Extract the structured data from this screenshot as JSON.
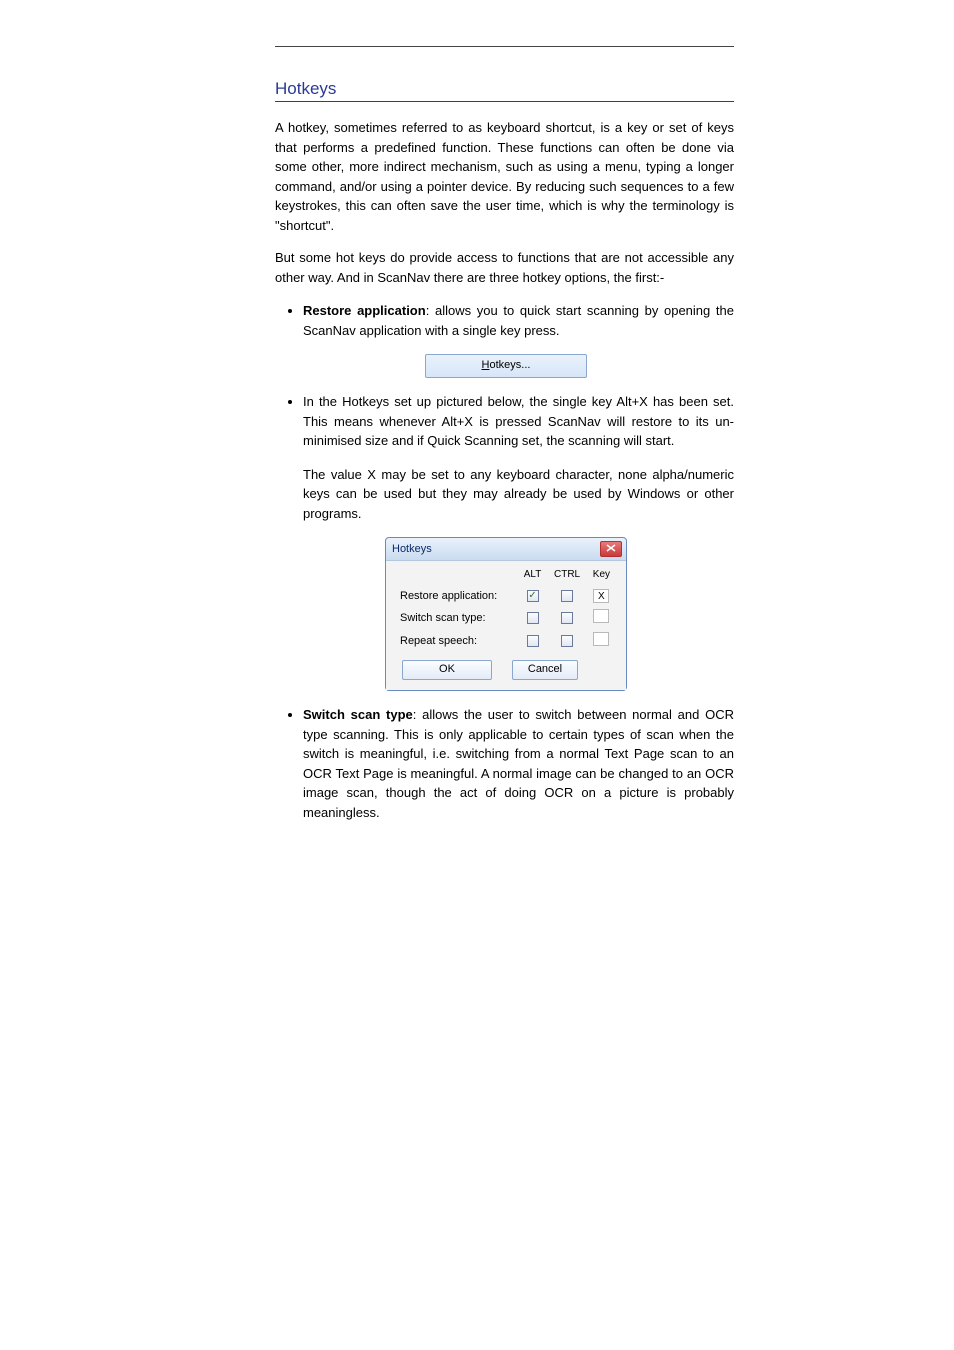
{
  "header": {
    "rule": true
  },
  "section": {
    "title": "Hotkeys"
  },
  "intro": [
    "A hotkey, sometimes referred to as keyboard shortcut, is a key or set of keys that performs a predefined function. These functions can often be done via some other, more indirect mechanism, such as using a menu, typing a longer command, and/or using a pointer device. By reducing such sequences to a few keystrokes, this can often save the user time, which is why the terminology is \"shortcut\".",
    "But some hot keys do provide access to functions that are not accessible any other way. And in ScanNav there are three hotkey options, the first:-"
  ],
  "bullets": [
    {
      "lead": "Restore application",
      "text": ": allows you to quick start scanning by opening the ScanNav application with a single key press.",
      "image": "hotkeys-btn"
    },
    {
      "lead": "In the Hotkeys set up",
      "text": " pictured below, the single key Alt+X has been set. This means whenever Alt+X is pressed ScanNav will restore to its un-minimised size and if Quick Scanning set, the scanning will start.",
      "extra": "The value X may be set to any keyboard character, none alpha/numeric keys can be used but they may already be used by Windows or other programs.",
      "dialog": true
    },
    {
      "lead": "Switch scan type",
      "text": ": allows the user to switch between normal and OCR type scanning. This is only applicable to certain types of scan when the switch is meaningful, i.e. switching from a normal Text Page scan to an OCR Text Page is meaningful. A normal image can be changed to an OCR image scan, though the act of doing OCR on a picture is probably meaningless."
    }
  ],
  "hotkeys_button": {
    "label": "Hotkeys..."
  },
  "dialog": {
    "title": "Hotkeys",
    "columns": [
      "ALT",
      "CTRL",
      "Key"
    ],
    "rows": [
      {
        "label": "Restore application:",
        "alt": true,
        "ctrl": false,
        "key": "X"
      },
      {
        "label": "Switch scan type:",
        "alt": false,
        "ctrl": false,
        "key": ""
      },
      {
        "label": "Repeat speech:",
        "alt": false,
        "ctrl": false,
        "key": ""
      }
    ],
    "ok": "OK",
    "cancel": "Cancel"
  }
}
